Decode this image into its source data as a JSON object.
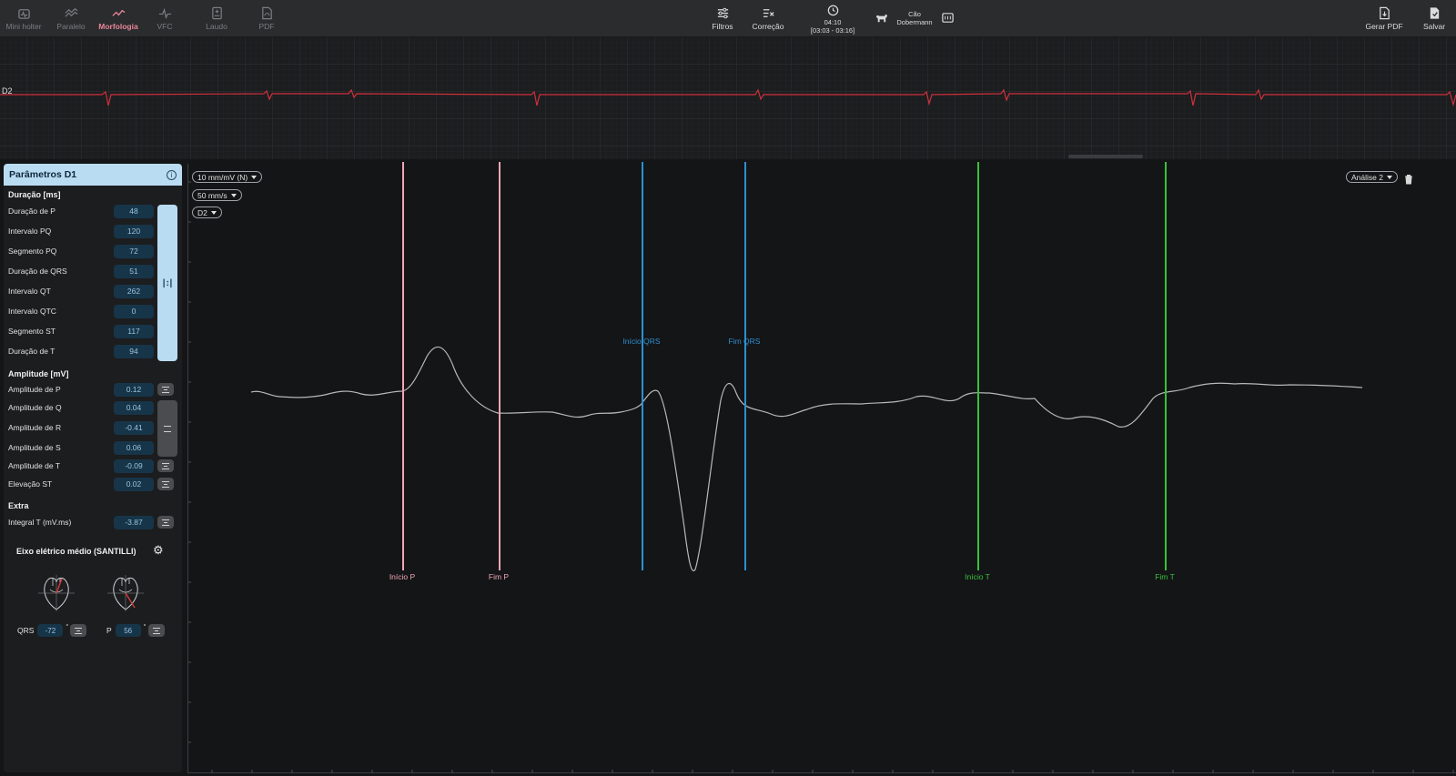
{
  "toolbar": {
    "left": [
      {
        "label": "Mini holter",
        "icon": "mini-holter-icon"
      },
      {
        "label": "Paralelo",
        "icon": "parallel-icon"
      },
      {
        "label": "Morfologia",
        "icon": "morphology-icon",
        "active": true
      },
      {
        "label": "VFC",
        "icon": "vfc-icon"
      },
      {
        "label": "Laudo",
        "icon": "report-icon"
      },
      {
        "label": "PDF",
        "icon": "pdf-icon"
      }
    ],
    "filters_label": "Filtros",
    "correction_label": "Correção",
    "time": "04:10",
    "time_range": "[03:03 - 03:16]",
    "species": "Cão",
    "breed": "Dobermann",
    "generate_pdf_label": "Gerar PDF",
    "save_label": "Salvar"
  },
  "strip": {
    "lead_label": "D2"
  },
  "panel": {
    "title": "Parâmetros D1",
    "duration_title": "Duração [ms]",
    "duration": [
      {
        "label": "Duração de P",
        "value": "48"
      },
      {
        "label": "Intervalo PQ",
        "value": "120"
      },
      {
        "label": "Segmento PQ",
        "value": "72"
      },
      {
        "label": "Duração de QRS",
        "value": "51"
      },
      {
        "label": "Intervalo QT",
        "value": "262"
      },
      {
        "label": "Intervalo QTC",
        "value": "0"
      },
      {
        "label": "Segmento ST",
        "value": "117"
      },
      {
        "label": "Duração de T",
        "value": "94"
      }
    ],
    "amplitude_title": "Amplitude [mV]",
    "amplitude": [
      {
        "label": "Amplitude de P",
        "value": "0.12"
      },
      {
        "label": "Amplitude de Q",
        "value": "0.04"
      },
      {
        "label": "Amplitude de R",
        "value": "-0.41"
      },
      {
        "label": "Amplitude de S",
        "value": "0.06"
      },
      {
        "label": "Amplitude de T",
        "value": "-0.09"
      },
      {
        "label": "Elevação ST",
        "value": "0.02"
      }
    ],
    "extra_title": "Extra",
    "extra": [
      {
        "label": "Integral T (mV.ms)",
        "value": "-3.87"
      }
    ],
    "axis_title": "Eixo elétrico médio (SANTILLI)",
    "axis": {
      "qrs_label": "QRS",
      "qrs_value": "-72",
      "p_label": "P",
      "p_value": "56",
      "degree": "°"
    }
  },
  "plot": {
    "gain": "10 mm/mV (N)",
    "speed": "50 mm/s",
    "lead": "D2",
    "analysis": "Análise 2",
    "markers": [
      {
        "label": "Início P",
        "color": "#f2a7b4"
      },
      {
        "label": "Fim P",
        "color": "#f2a7b4"
      },
      {
        "label": "Início QRS",
        "color": "#2e8fd1"
      },
      {
        "label": "Fim QRS",
        "color": "#2e8fd1"
      },
      {
        "label": "Início T",
        "color": "#37c23a"
      },
      {
        "label": "Fim T",
        "color": "#37c23a"
      }
    ]
  },
  "colors": {
    "accent": "#b9dcf2",
    "strip_trace": "#d0303d",
    "value_bg": "#173549",
    "active_tab": "#e8869a"
  }
}
